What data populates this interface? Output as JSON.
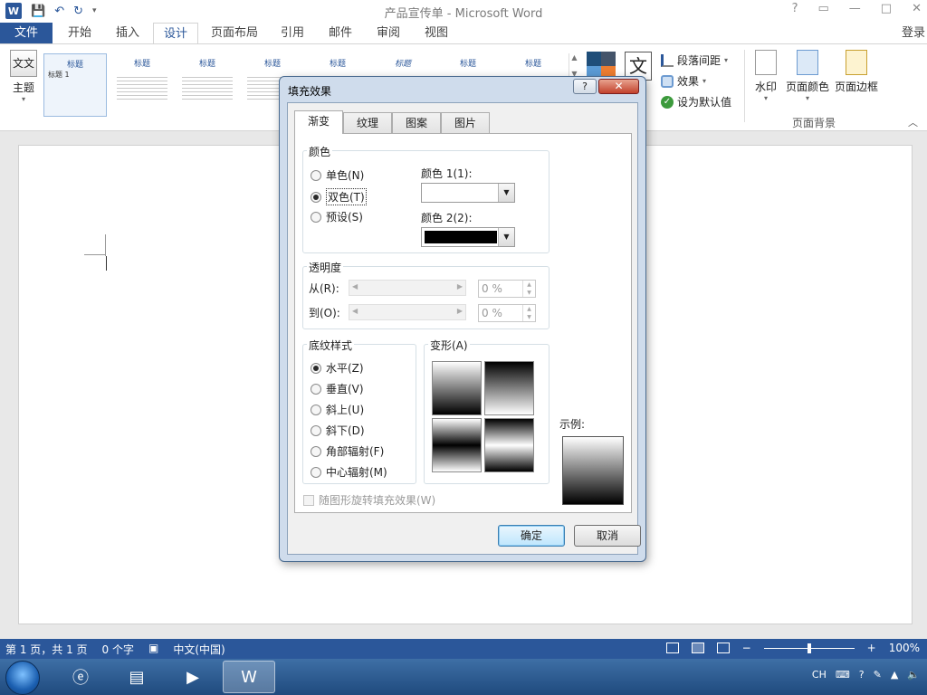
{
  "window": {
    "title": "产品宣传单 - Microsoft Word",
    "controls": [
      "?",
      "▭",
      "—",
      "□",
      "✕"
    ],
    "app_icon": "W"
  },
  "tabs": {
    "file": "文件",
    "items": [
      "开始",
      "插入",
      "设计",
      "页面布局",
      "引用",
      "邮件",
      "审阅",
      "视图"
    ],
    "active": "设计",
    "login": "登录"
  },
  "ribbon": {
    "theme_label": "主题",
    "theme_icon_text": "文文",
    "style_thumbs": [
      "标题",
      "标题",
      "标题",
      "标题",
      "标题",
      "标题",
      "标题",
      "标题"
    ],
    "style_first_heading": "标题 1",
    "fonts_glyph": "文",
    "para_spacing": "段落间距",
    "effects": "效果",
    "set_default": "设为默认值",
    "watermark": "水印",
    "page_color": "页面颜色",
    "page_borders": "页面边框",
    "page_bg_group": "页面背景"
  },
  "dialog": {
    "title": "填充效果",
    "help": "?",
    "close": "✕",
    "tabs": [
      "渐变",
      "纹理",
      "图案",
      "图片"
    ],
    "active_tab": "渐变",
    "colors": {
      "group_label": "颜色",
      "options": [
        "单色(N)",
        "双色(T)",
        "预设(S)"
      ],
      "selected": "双色(T)",
      "color1_label": "颜色 1(1):",
      "color1_value": "#ffffff",
      "color2_label": "颜色 2(2):",
      "color2_value": "#000000"
    },
    "transparency": {
      "group_label": "透明度",
      "from_label": "从(R):",
      "from_value": "0 %",
      "to_label": "到(O):",
      "to_value": "0 %"
    },
    "shading": {
      "group_label": "底纹样式",
      "options": [
        "水平(Z)",
        "垂直(V)",
        "斜上(U)",
        "斜下(D)",
        "角部辐射(F)",
        "中心辐射(M)"
      ],
      "selected": "水平(Z)"
    },
    "variants_label": "变形(A)",
    "sample_label": "示例:",
    "rotate_checkbox": "随图形旋转填充效果(W)",
    "ok": "确定",
    "cancel": "取消"
  },
  "status": {
    "page": "第 1 页，共 1 页",
    "words": "0 个字",
    "language": "中文(中国)",
    "zoom": "100%",
    "zoom_minus": "−",
    "zoom_plus": "+"
  },
  "taskbar": {
    "tray_lang": "CH"
  }
}
